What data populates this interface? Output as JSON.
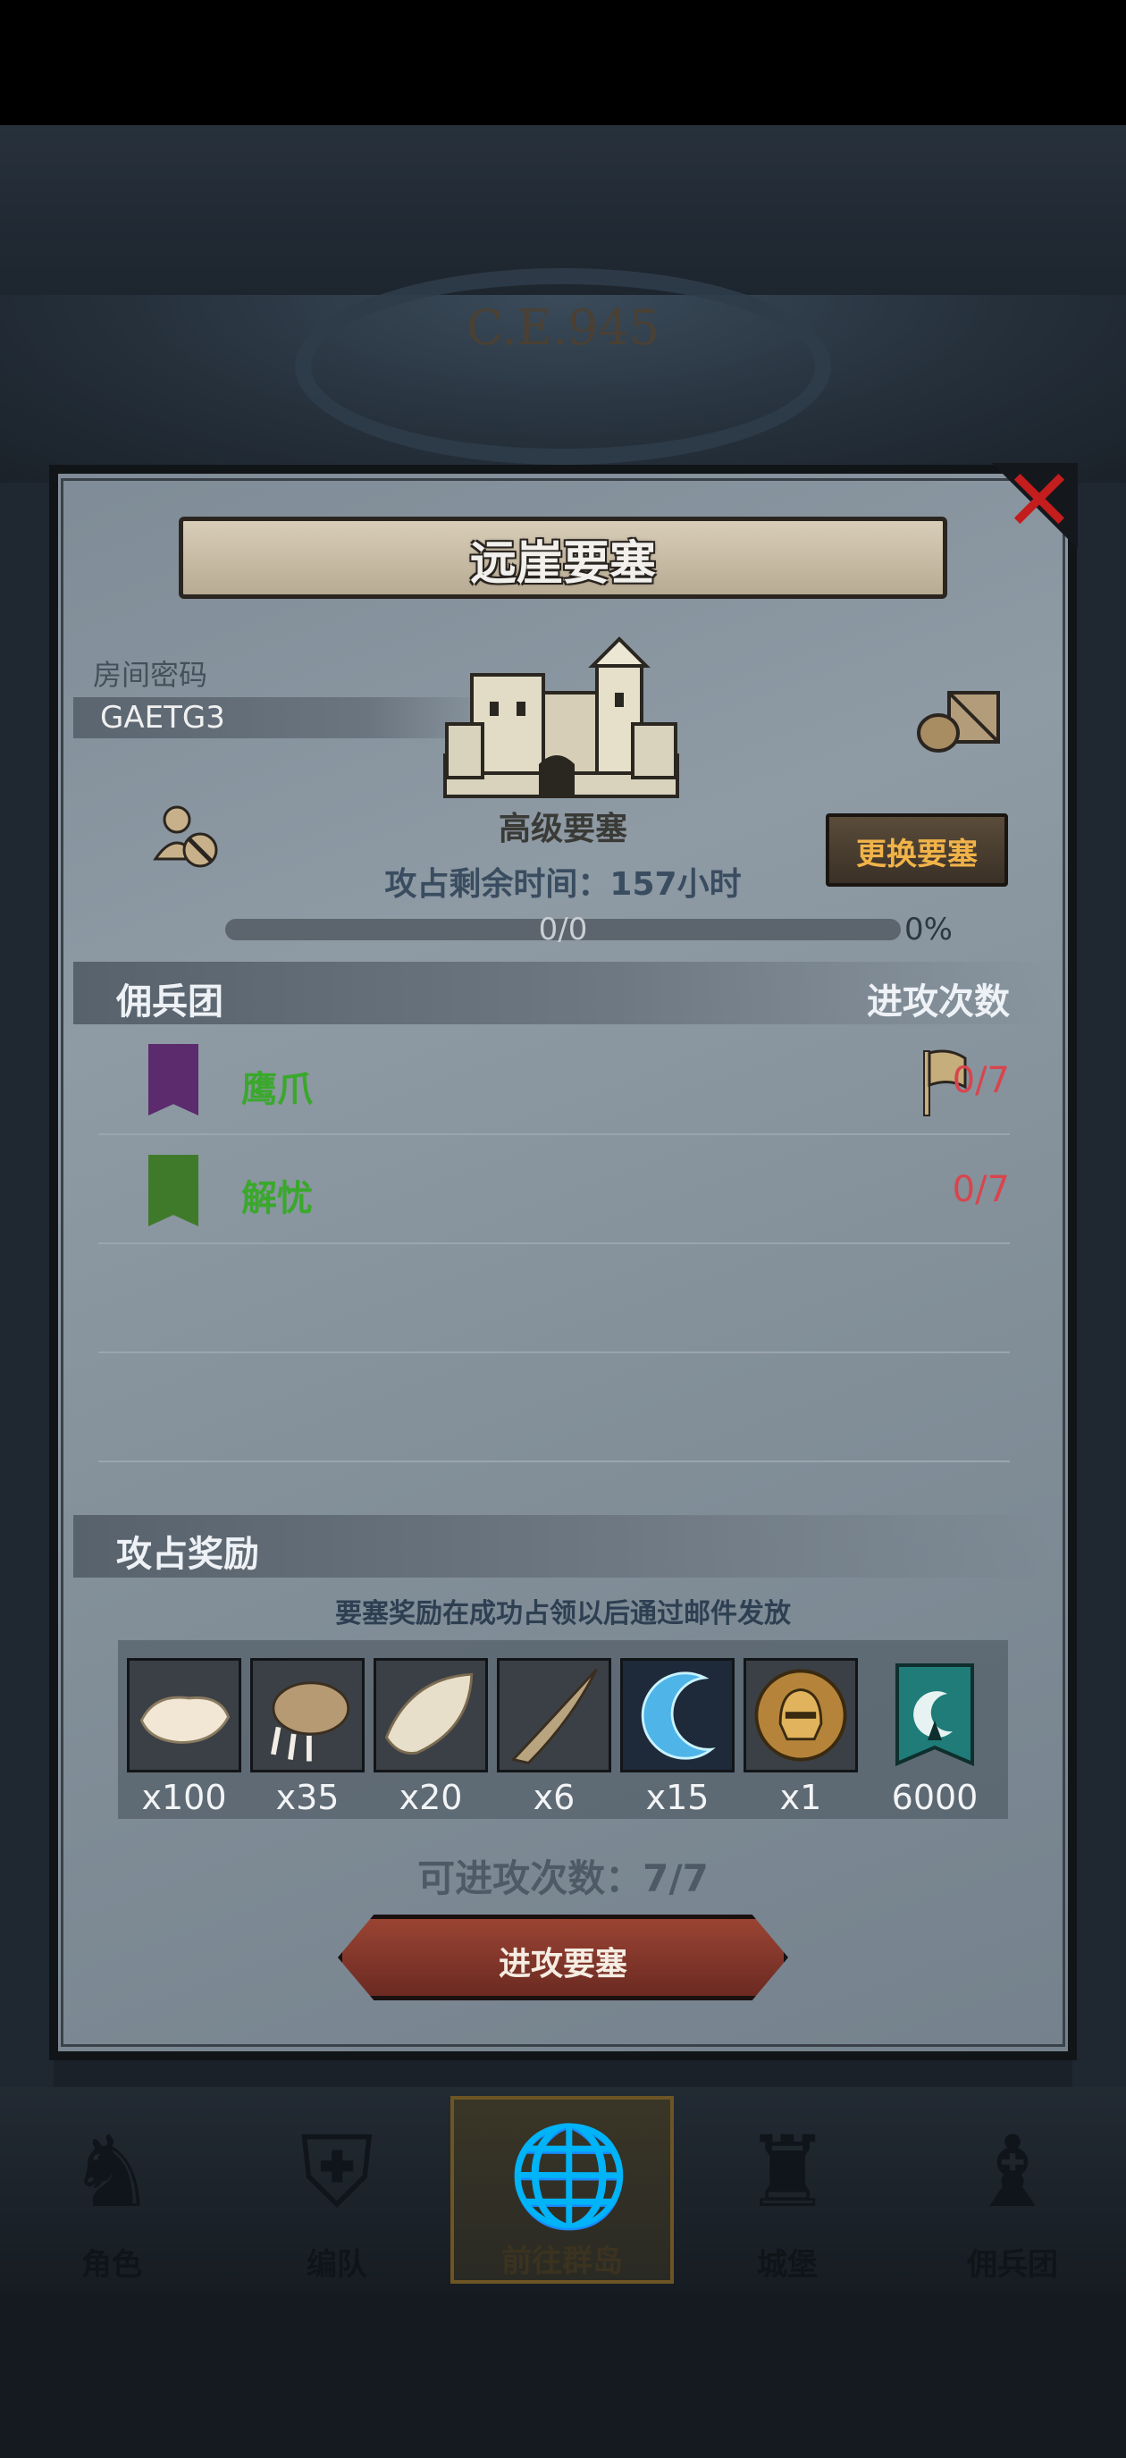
{
  "background": {
    "era_text": "C.E.945"
  },
  "dialog": {
    "title": "远崖要塞",
    "room_password_label": "房间密码",
    "room_password": "GAETG3",
    "fortress_grade": "高级要塞",
    "swap_button": "更换要塞",
    "time_left": "攻占剩余时间：157小时",
    "progress": {
      "text": "0/0",
      "percent_text": "0%",
      "value": 0
    },
    "mercenary_header": "佣兵团",
    "attack_times_header": "进攻次数",
    "mercenaries": [
      {
        "name": "鹰爪",
        "count": "0/7",
        "banner_color": "#5b2b6e",
        "has_flag": true
      },
      {
        "name": "解忧",
        "count": "0/7",
        "banner_color": "#3f7a2a",
        "has_flag": false
      }
    ],
    "reward_header": "攻占奖励",
    "reward_note": "要塞奖励在成功占领以后通过邮件发放",
    "rewards": [
      {
        "icon": "fur-pelt-icon",
        "qty": "x100"
      },
      {
        "icon": "claw-icon",
        "qty": "x35"
      },
      {
        "icon": "feather-hide-icon",
        "qty": "x20"
      },
      {
        "icon": "horn-icon",
        "qty": "x6"
      },
      {
        "icon": "crescent-gem-icon",
        "qty": "x15"
      },
      {
        "icon": "helmet-medal-icon",
        "qty": "x1"
      },
      {
        "icon": "guild-banner-icon",
        "qty": "6000"
      }
    ],
    "attack_count": "可进攻次数：7/7",
    "attack_button": "进攻要塞"
  },
  "bottom_nav": [
    {
      "label": "角色",
      "icon": "knight-icon",
      "active": false
    },
    {
      "label": "编队",
      "icon": "helmet-icon",
      "active": false
    },
    {
      "label": "前往群岛",
      "icon": "globe-icon",
      "active": true
    },
    {
      "label": "城堡",
      "icon": "castle-icon",
      "active": false
    },
    {
      "label": "佣兵团",
      "icon": "mercenary-icon",
      "active": false
    }
  ],
  "colors": {
    "title_banner": "#d8cdb8",
    "mercenary_name": "#3aa82c",
    "count_red": "#d8454c",
    "swap_text": "#f1b349",
    "close_red": "#c31d1d"
  }
}
